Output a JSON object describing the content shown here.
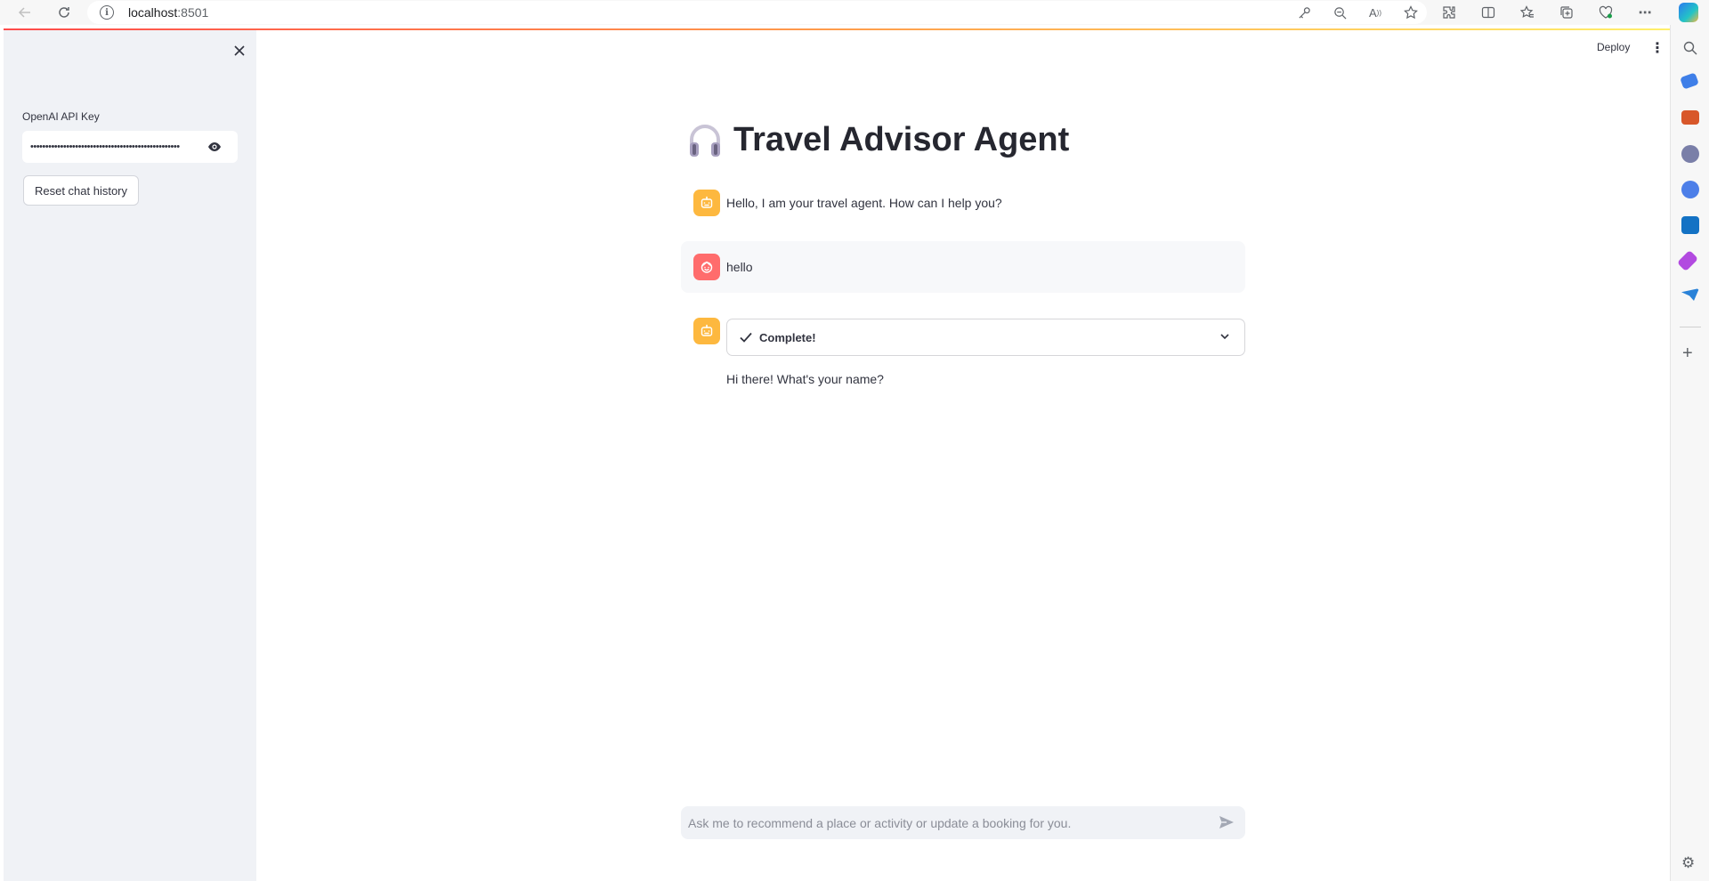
{
  "browser": {
    "url_host": "localhost",
    "url_port": ":8501"
  },
  "sidebar": {
    "api_key_label": "OpenAI API Key",
    "api_key_value": "••••••••••••••••••••••••••••••••••••••••••••••••••",
    "reset_label": "Reset chat history"
  },
  "header": {
    "deploy_label": "Deploy",
    "menu_glyph": "⋮"
  },
  "main": {
    "title": "Travel Advisor Agent",
    "title_icon": "headphones-icon"
  },
  "chat": {
    "messages": [
      {
        "role": "assistant",
        "text": "Hello, I am your travel agent. How can I help you?"
      },
      {
        "role": "user",
        "text": "hello"
      },
      {
        "role": "assistant",
        "status_label": "Complete!",
        "text": "Hi there! What's your name?"
      }
    ],
    "input_placeholder": "Ask me to recommend a place or activity or update a booking for you."
  },
  "colors": {
    "sidebar_bg": "#f0f2f6",
    "bot_avatar": "#fdb83f",
    "user_avatar": "#ff6c6c",
    "accent": "#ff4b4b"
  }
}
